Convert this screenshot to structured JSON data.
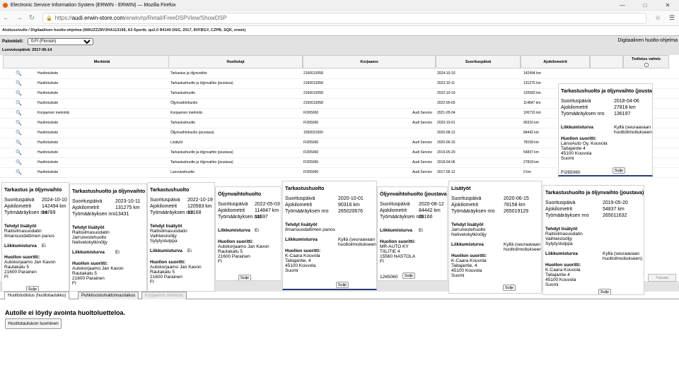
{
  "window": {
    "title": "Electronic Service Information System (ERWIN - ERWIN) — Mozilla Firefox"
  },
  "browser": {
    "url_prefix": "https://",
    "url_domain": "audi.erwin-store.com",
    "url_path": "/erwin/rp/Retail/FreeDSPView/ShowDSP"
  },
  "breadcrumb": "Aloitussivulle / Digitaalinen huolto-ohjelma (WAUZZZ8V3HA113199, A3 Sportb. qu2.0 R4140 DSG, 2017, 8VFBGY, CZPB, SQK, erwin)",
  "header": {
    "right_title": "Digitaalinen huolto-ohjelma",
    "language_label": "Painokieli:",
    "language_value": "fi-FI (Finnish)",
    "delivery_date": "Luovutuspäivä: 2017-06-14"
  },
  "table": {
    "headers": [
      "Merkintä",
      "Huoltolaji",
      "Korjaamo",
      "Suorituspäivä",
      "Ajokilometrit",
      "Todistus valmis"
    ],
    "rows": [
      {
        "merkinta": "Huoltotuloste",
        "huoltolaji": "Tarkastus ja öljynvaihto",
        "korjaamo": "2160013058",
        "brand": "",
        "date": "2024-10-10",
        "km": "142494 km"
      },
      {
        "merkinta": "Huoltotuloste",
        "huoltolaji": "Tarkastushuolto ja öljynvaihto (joustava)",
        "korjaamo": "2160013058",
        "brand": "",
        "date": "2023-10-11",
        "km": "131275 km"
      },
      {
        "merkinta": "Huoltotuloste",
        "huoltolaji": "Tarkastushuolto",
        "korjaamo": "2160013058",
        "brand": "",
        "date": "2022-10-19",
        "km": "120583 km"
      },
      {
        "merkinta": "Huoltotuloste",
        "huoltolaji": "Öljynvaihtohuolto",
        "korjaamo": "2160013058",
        "brand": "",
        "date": "2022-05-03",
        "km": "114847 km"
      },
      {
        "merkinta": "Korjaamon merkintä",
        "huoltolaji": "Korjaamon merkintä",
        "korjaamo": "FI265060",
        "brand": "Audi Service",
        "date": "2021-05-04",
        "km": "106715 km"
      },
      {
        "merkinta": "Huoltotuloste",
        "huoltolaji": "Tarkastushuolto",
        "korjaamo": "FI265060",
        "brand": "Audi Service",
        "date": "2020-10-01",
        "km": "90316 km"
      },
      {
        "merkinta": "Huoltotuloste",
        "huoltolaji": "Öljynvaihtohuolto (joustava)",
        "korjaamo": "1550031500",
        "brand": "",
        "date": "2020-08-12",
        "km": "84442 km"
      },
      {
        "merkinta": "Huoltotuloste",
        "huoltolaji": "Lisätyöt",
        "korjaamo": "FI265060",
        "brand": "Audi Service",
        "date": "2020-06-15",
        "km": "78158 km"
      },
      {
        "merkinta": "Huoltotuloste",
        "huoltolaji": "Tarkastushuolto ja öljynvaihto (joustava)",
        "korjaamo": "FI265060",
        "brand": "Audi Service",
        "date": "2019-05-20",
        "km": "54837 km"
      },
      {
        "merkinta": "Huoltotuloste",
        "huoltolaji": "Tarkastushuolto ja öljynvaihto (joustava)",
        "korjaamo": "FI265060",
        "brand": "Audi Service",
        "date": "2018-04-06",
        "km": "27818 km"
      },
      {
        "merkinta": "Huoltotuloste",
        "huoltolaji": "Luovutushuolto",
        "korjaamo": "FI265060",
        "brand": "Audi Service",
        "date": "2017-06-12",
        "km": "0 km"
      }
    ]
  },
  "labels": {
    "date": "Suorituspäivä",
    "km": "Ajokilometrit",
    "order": "Työmääräyksen nro",
    "extra": "Tehdyt lisätyöt",
    "safety": "Liikkumisturva",
    "by": "Huollon suoritti:",
    "close": "Sulje"
  },
  "popups": [
    {
      "title": "Tarkastus ja öljynvaihto",
      "date": "2024-10-10",
      "km": "142494 km",
      "order": "14789",
      "extra": [
        "Raitisilmasuodatin",
        "Ilmansuodattimen panos"
      ],
      "safety": "Ei",
      "by": [
        "Autokorjaamo Jan Kavon",
        "Rautakatu 5",
        "21600 Parainen",
        "FI"
      ]
    },
    {
      "title": "Tarkastushuolto ja öljynvaihto (joustava)",
      "date": "2023-10-11",
      "km": "131275 km",
      "order": "13431",
      "extra": [
        "Raitisilmasuodatin",
        "Jarrunestehuolto",
        "Nelivetokytkinöljy"
      ],
      "safety": "Ei",
      "by": [
        "Autokorjaamo Jan Kavon",
        "Rautakatu 5",
        "21600 Parainen",
        "FI"
      ]
    },
    {
      "title": "Tarkastushuolto",
      "date": "2022-10-19",
      "km": "120583 km",
      "order": "12168",
      "extra": [
        "Raitisilmasuodatin",
        "Vaihteistoöljy",
        "Sytytystulppa"
      ],
      "safety": "Ei",
      "by": [
        "Autokorjaamo Jan Kavon",
        "Rautakatu 5",
        "21600 Parainen",
        "FI"
      ]
    },
    {
      "title": "Öljynvaihtohuolto",
      "date": "2022-05-03",
      "km": "114847 km",
      "order": "11597",
      "safety": "Ei",
      "by": [
        "Autokorjaamo Jan Kavon",
        "Rautakatu 5",
        "21600 Parainen",
        "FI"
      ]
    },
    {
      "title": "Tarkastushuolto",
      "date": "2020-10-01",
      "km": "90316 km",
      "order": "265020676",
      "extra": [
        "Ilmansuodattimen panos"
      ],
      "safety": "Kyllä (seuraavaan huoltoilmoitukseen)",
      "by": [
        "K-Caara Kouvola",
        "Taitajantie, 4",
        "45100 Kouvola",
        "Suomi"
      ]
    },
    {
      "title": "Öljynvaihtohuolto (joustava)",
      "date": "2020-08-12",
      "km": "84442 km",
      "order": "29166",
      "safety": "Ei",
      "by": [
        "MR-AUTO KY",
        "TIILITIE 4",
        "15560 NASTOLA",
        "FI"
      ],
      "footer": "1265060"
    },
    {
      "title": "Lisätyöt",
      "date": "2020-06-15",
      "km": "78158 km",
      "order": "265019129",
      "extra": [
        "Jarrunestehuolto",
        "Nelivetokytkinöljy"
      ],
      "safety": "Kyllä (seuraavaan huoltoilmoitukseen)",
      "by": [
        "K-Caara Kouvola",
        "Taitajantie, 4",
        "45100 Kouvola",
        "Suomi"
      ]
    },
    {
      "title": "Tarkastushuolto ja öljynvaihto (joustava)",
      "date": "2019-05-20",
      "km": "54837 km",
      "order": "265011632",
      "extra": [
        "Raitisilmasuodatin",
        "Vaihteistoöljy",
        "Sytytystulppa"
      ],
      "safety": "Kyllä (seuraavaan huoltoilmoitukseen)",
      "by": [
        "K-Caara Kouvola",
        "Taitajantie 4",
        "45100 Kouvola",
        "Suomi"
      ]
    },
    {
      "title": "Tarkastushuolto ja öljynvaihto (joustava)",
      "date": "2018-04-06",
      "km": "27818 km",
      "order": "136197",
      "safety": "Kyllä (seuraavaan huoltoilmoitukseen)",
      "by": [
        "LänsiAuto Oy, Kouvola",
        "Taitajantie 4",
        "45100 Kouvola",
        "Suomi"
      ],
      "footer": "FI265060"
    }
  ],
  "tabs": [
    "Huoltotodistus (huoltotaulukko)",
    "Puhkiruostumattomuustakuu",
    "Korjaamon merkintä"
  ],
  "tolostus_label": "Tulosta",
  "message": "Autolle ei löydy avointa huoltoluetteloa.",
  "create_button": "Huoltotaulukon luominen"
}
